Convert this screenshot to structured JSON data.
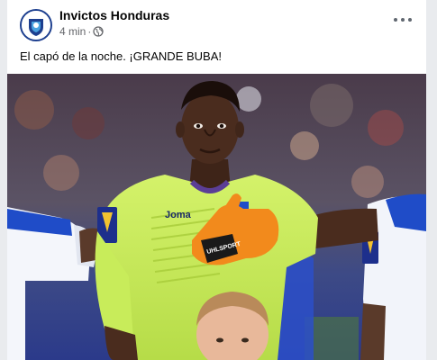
{
  "post": {
    "page_name": "Invictos Honduras",
    "timestamp": "4 min",
    "separator": "·",
    "privacy_icon": "globe-icon",
    "more_icon": "more-options-icon",
    "caption": "El capó de la noche. ¡GRANDE BUBA!"
  },
  "photo": {
    "jersey_text": "Joma",
    "glove_text": "UHLSPORT"
  },
  "colors": {
    "jersey": "#c8ec5a",
    "glove": "#f28a1c",
    "stadium_blue": "#2e3a6c",
    "honduras_blue": "#1d4fc7"
  }
}
